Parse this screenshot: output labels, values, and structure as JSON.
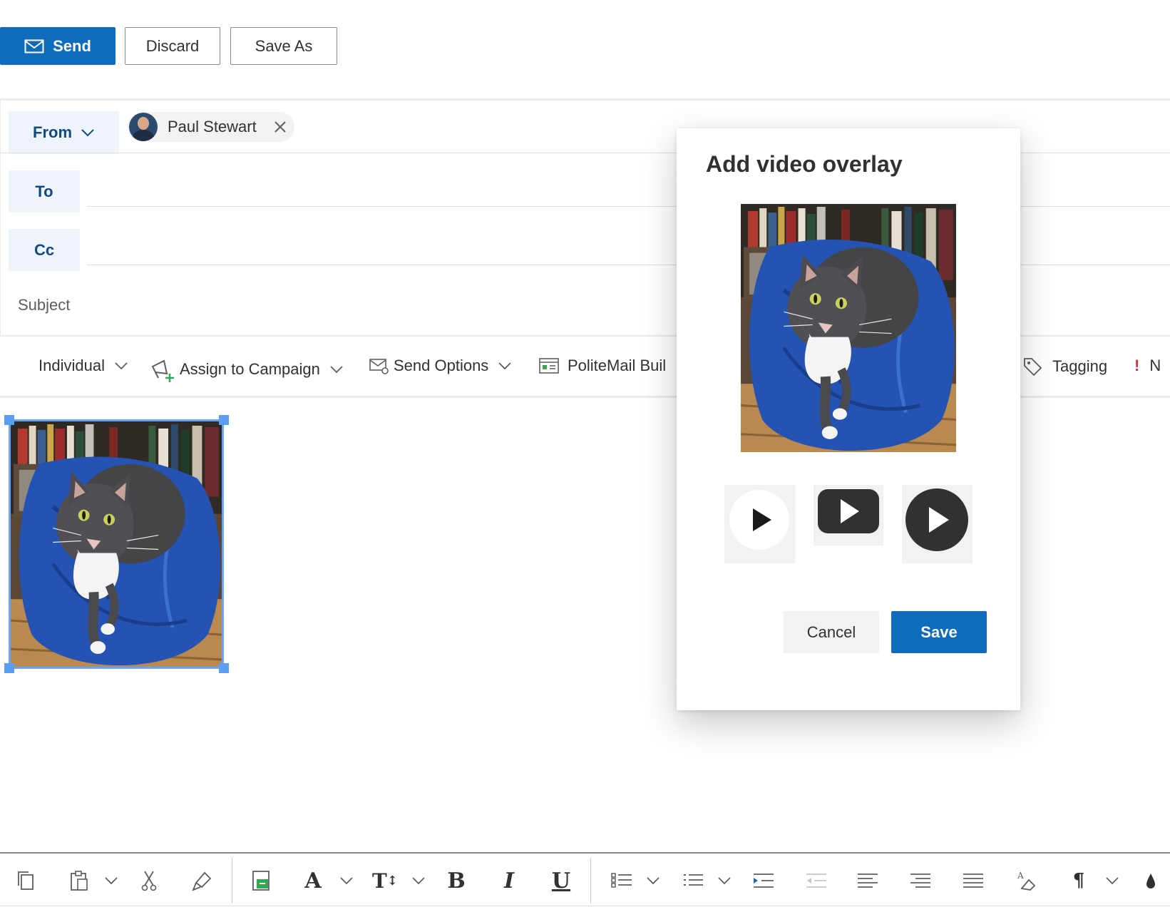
{
  "toolbar": {
    "send_label": "Send",
    "discard_label": "Discard",
    "save_as_label": "Save As"
  },
  "header": {
    "from_label": "From",
    "to_label": "To",
    "cc_label": "Cc",
    "subject_placeholder": "Subject",
    "sender_name": "Paul Stewart"
  },
  "ribbon": {
    "individual_label": "Individual",
    "assign_campaign_label": "Assign to Campaign",
    "send_options_label": "Send Options",
    "politemail_builder_label": "PoliteMail Buil",
    "tagging_label": "Tagging",
    "next_label": "N"
  },
  "dialog": {
    "title": "Add video overlay",
    "cancel_label": "Cancel",
    "save_label": "Save"
  },
  "colors": {
    "accent": "#0f6cbd",
    "field_bg": "#eff4fb",
    "selection": "#5b9ef2"
  },
  "icons": {
    "send": "envelope-icon",
    "campaign": "megaphone-icon",
    "send_options": "envelope-gear-icon",
    "builder": "builder-icon",
    "tagging": "tag-icon",
    "importance": "exclamation-icon"
  }
}
